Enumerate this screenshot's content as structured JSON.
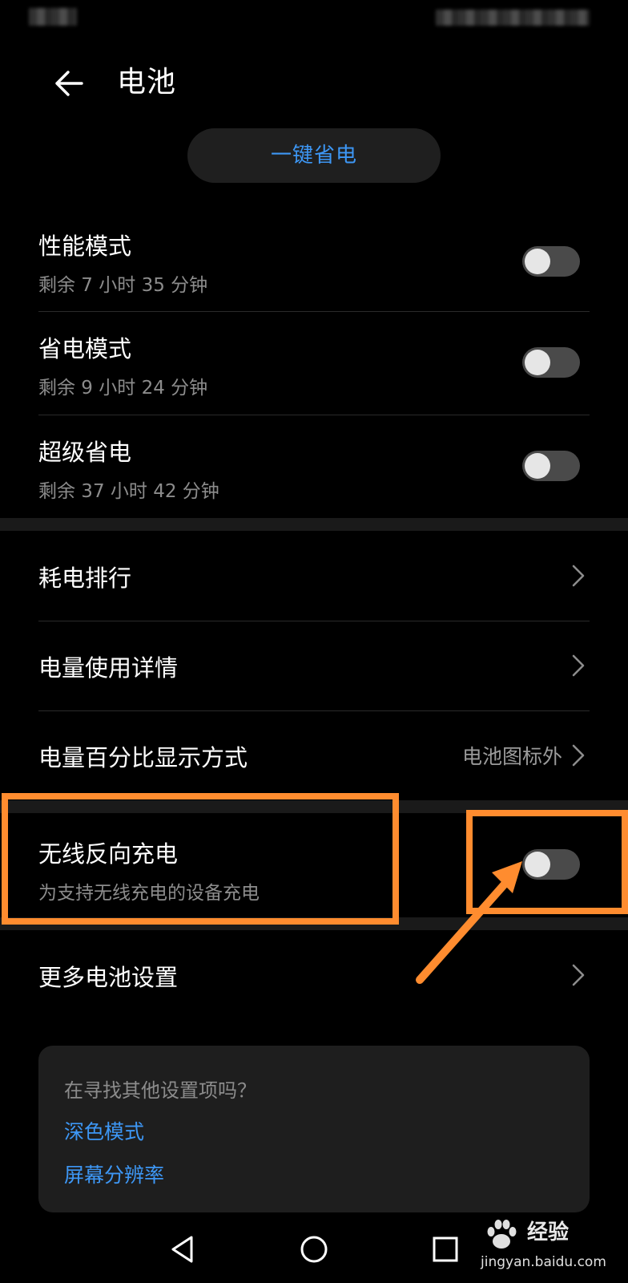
{
  "header": {
    "title": "电池"
  },
  "one_key_button": {
    "label": "一键省电"
  },
  "modes": [
    {
      "title": "性能模式",
      "subtitle": "剩余 7 小时 35 分钟",
      "enabled": false
    },
    {
      "title": "省电模式",
      "subtitle": "剩余 9 小时 24 分钟",
      "enabled": false
    },
    {
      "title": "超级省电",
      "subtitle": "剩余 37 小时 42 分钟",
      "enabled": false
    }
  ],
  "settings": [
    {
      "title": "耗电排行"
    },
    {
      "title": "电量使用详情"
    },
    {
      "title": "电量百分比显示方式",
      "value": "电池图标外"
    }
  ],
  "wireless_reverse": {
    "title": "无线反向充电",
    "subtitle": "为支持无线充电的设备充电",
    "enabled": false
  },
  "more_settings": {
    "title": "更多电池设置"
  },
  "suggest": {
    "prompt": "在寻找其他设置项吗？",
    "links": [
      "深色模式",
      "屏幕分辨率"
    ]
  },
  "watermark": {
    "brand": "经验",
    "url": "jingyan.baidu.com"
  },
  "colors": {
    "accent": "#3d97f5",
    "annotation": "#ff8c2f",
    "background": "#000000"
  }
}
